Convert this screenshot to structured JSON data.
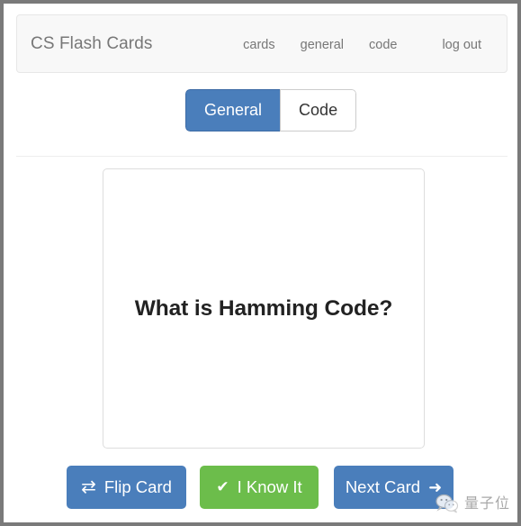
{
  "window": {
    "frame_border_color": "#7a7a7a",
    "background": "#ffffff"
  },
  "navbar": {
    "brand": "CS Flash Cards",
    "background": "#f8f8f8",
    "border_color": "#e7e7e7",
    "text_color": "#777777",
    "links": [
      {
        "label": "cards",
        "name": "nav-link-cards"
      },
      {
        "label": "general",
        "name": "nav-link-general"
      },
      {
        "label": "code",
        "name": "nav-link-code"
      },
      {
        "label": "log out",
        "name": "nav-link-log-out"
      }
    ]
  },
  "category_toggle": {
    "active": "General",
    "options": [
      {
        "label": "General",
        "active": true
      },
      {
        "label": "Code",
        "active": false
      }
    ],
    "active_color": "#4a7ebb",
    "inactive_color": "#ffffff"
  },
  "card": {
    "question": "What is Hamming Code?",
    "border_color": "#dddddd",
    "background": "#ffffff",
    "text_color": "#222222"
  },
  "actions": {
    "flip": {
      "label": "Flip Card",
      "icon": "exchange-icon",
      "icon_glyph": "⇄",
      "color": "#4a7ebb"
    },
    "know": {
      "label": "I Know It",
      "icon": "check-icon",
      "icon_glyph": "✔",
      "color": "#6cbd4b"
    },
    "next": {
      "label": "Next Card",
      "icon": "arrow-right-icon",
      "icon_glyph": "➜",
      "color": "#4a7ebb"
    }
  },
  "watermark": {
    "text": "量子位",
    "icon": "wechat-icon",
    "color": "#9a9a9a"
  }
}
